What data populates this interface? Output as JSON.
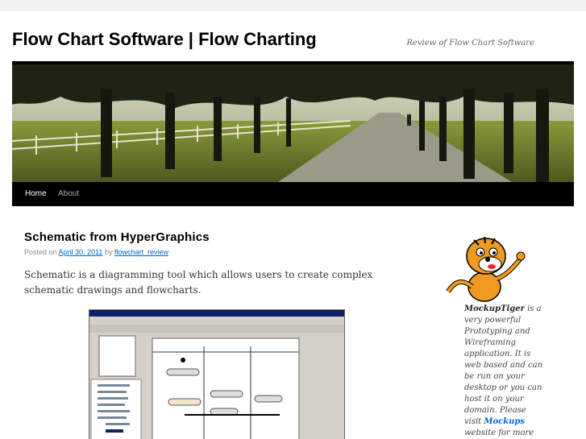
{
  "site": {
    "title": "Flow Chart Software | Flow Charting",
    "description": "Review of Flow Chart Software"
  },
  "nav": {
    "items": [
      {
        "label": "Home",
        "current": true
      },
      {
        "label": "About",
        "current": false
      }
    ]
  },
  "post": {
    "title": "Schematic from HyperGraphics",
    "meta_prefix": "Posted on",
    "date": "April 30, 2011",
    "meta_by": "by",
    "author": "flowchart_review",
    "body": "Schematic is a diagramming tool which allows users to create complex schematic drawings and flowcharts."
  },
  "sidebar": {
    "brand": "MockupTiger",
    "text_1": " is a very powerful Prototyping and Wireframing application. It is web based and can be run on your desktop or you can host it on your domain. Please visit ",
    "link": "Mockups",
    "text_2": " website for more details"
  },
  "colors": {
    "link": "#0066cc",
    "nav_bg": "#000000",
    "page_bg": "#f1f1f1"
  }
}
